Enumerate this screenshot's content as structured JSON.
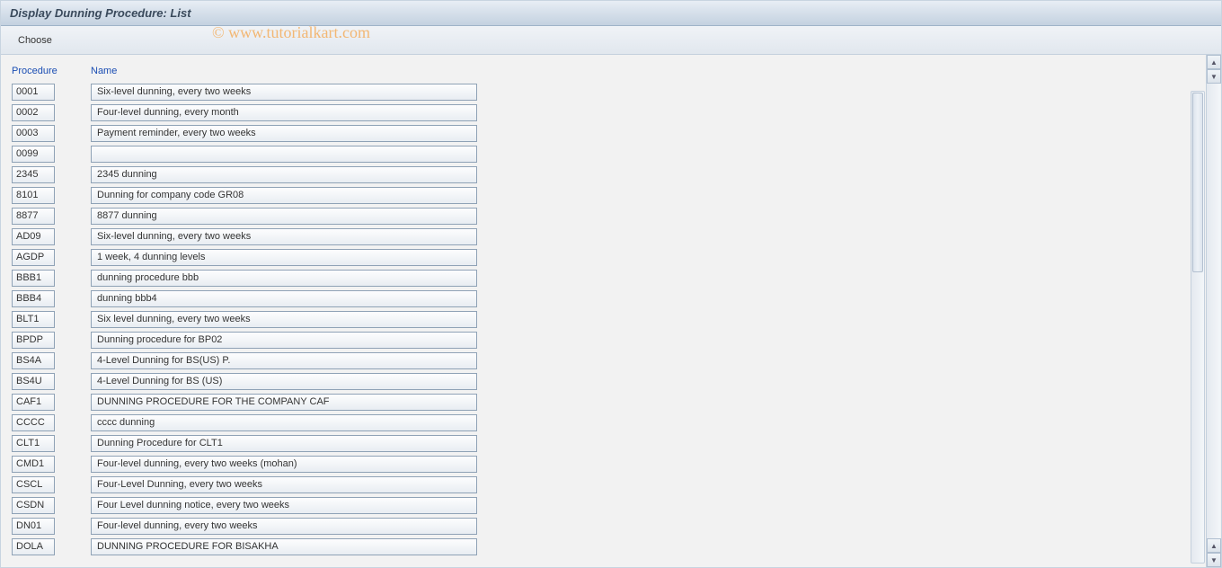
{
  "title": "Display Dunning Procedure: List",
  "toolbar": {
    "choose_label": "Choose"
  },
  "watermark": "© www.tutorialkart.com",
  "headers": {
    "procedure": "Procedure",
    "name": "Name"
  },
  "rows": [
    {
      "proc": "0001",
      "name": "Six-level dunning, every two weeks"
    },
    {
      "proc": "0002",
      "name": "Four-level dunning, every month"
    },
    {
      "proc": "0003",
      "name": "Payment reminder, every two weeks"
    },
    {
      "proc": "0099",
      "name": ""
    },
    {
      "proc": "2345",
      "name": " 2345 dunning"
    },
    {
      "proc": "8101",
      "name": "Dunning for company code GR08"
    },
    {
      "proc": "8877",
      "name": "8877 dunning"
    },
    {
      "proc": "AD09",
      "name": "Six-level dunning, every two weeks"
    },
    {
      "proc": "AGDP",
      "name": "1 week, 4 dunning levels"
    },
    {
      "proc": "BBB1",
      "name": "dunning procedure bbb"
    },
    {
      "proc": "BBB4",
      "name": "dunning bbb4"
    },
    {
      "proc": "BLT1",
      "name": "Six level dunning, every two weeks"
    },
    {
      "proc": "BPDP",
      "name": "Dunning procedure for BP02"
    },
    {
      "proc": "BS4A",
      "name": "4-Level Dunning for BS(US) P."
    },
    {
      "proc": "BS4U",
      "name": "4-Level Dunning for BS (US)"
    },
    {
      "proc": "CAF1",
      "name": "DUNNING PROCEDURE FOR THE COMPANY CAF"
    },
    {
      "proc": "CCCC",
      "name": "cccc dunning"
    },
    {
      "proc": "CLT1",
      "name": "Dunning Procedure for CLT1"
    },
    {
      "proc": "CMD1",
      "name": "Four-level dunning, every two weeks (mohan)"
    },
    {
      "proc": "CSCL",
      "name": "Four-Level Dunning, every two weeks"
    },
    {
      "proc": "CSDN",
      "name": "Four Level dunning notice, every two weeks"
    },
    {
      "proc": "DN01",
      "name": "Four-level dunning, every two weeks"
    },
    {
      "proc": "DOLA",
      "name": "DUNNING PROCEDURE FOR BISAKHA"
    }
  ]
}
